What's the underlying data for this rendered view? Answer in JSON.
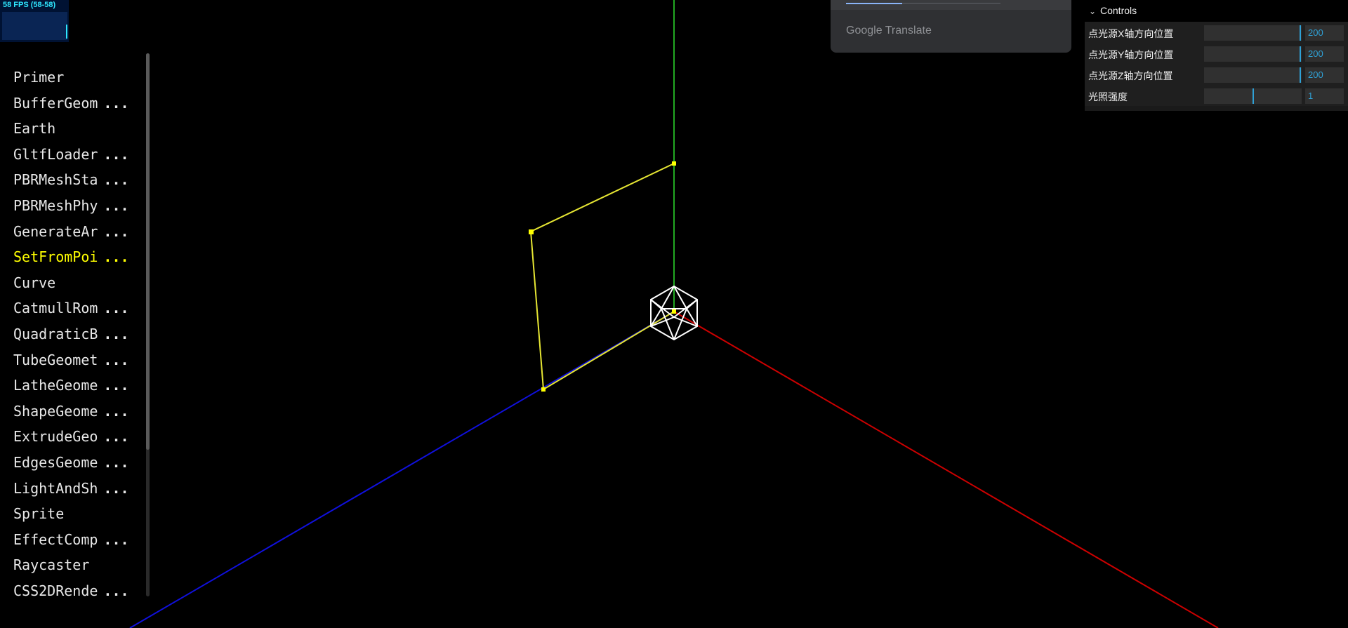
{
  "stats": {
    "fps_text": "58 FPS (58-58)"
  },
  "sidebar": {
    "items": [
      {
        "label": "Primer",
        "truncated": false,
        "active": false
      },
      {
        "label": "BufferGeom",
        "truncated": true,
        "active": false
      },
      {
        "label": "Earth",
        "truncated": false,
        "active": false
      },
      {
        "label": "GltfLoader",
        "truncated": true,
        "active": false
      },
      {
        "label": "PBRMeshSta",
        "truncated": true,
        "active": false
      },
      {
        "label": "PBRMeshPhy",
        "truncated": true,
        "active": false
      },
      {
        "label": "GenerateAr",
        "truncated": true,
        "active": false
      },
      {
        "label": "SetFromPoi",
        "truncated": true,
        "active": true
      },
      {
        "label": "Curve",
        "truncated": false,
        "active": false
      },
      {
        "label": "CatmullRom",
        "truncated": true,
        "active": false
      },
      {
        "label": "QuadraticB",
        "truncated": true,
        "active": false
      },
      {
        "label": "TubeGeomet",
        "truncated": true,
        "active": false
      },
      {
        "label": "LatheGeome",
        "truncated": true,
        "active": false
      },
      {
        "label": "ShapeGeome",
        "truncated": true,
        "active": false
      },
      {
        "label": "ExtrudeGeo",
        "truncated": true,
        "active": false
      },
      {
        "label": "EdgesGeome",
        "truncated": true,
        "active": false
      },
      {
        "label": "LightAndSh",
        "truncated": true,
        "active": false
      },
      {
        "label": "Sprite",
        "truncated": false,
        "active": false
      },
      {
        "label": "EffectComp",
        "truncated": true,
        "active": false
      },
      {
        "label": "Raycaster",
        "truncated": false,
        "active": false
      },
      {
        "label": "CSS2DRende",
        "truncated": true,
        "active": false
      }
    ],
    "ellipsis": "..."
  },
  "translate": {
    "brand": "Google Translate"
  },
  "controls": {
    "title": "Controls",
    "rows": [
      {
        "label": "点光源X轴方向位置",
        "value": "200",
        "level": 0.99
      },
      {
        "label": "点光源Y轴方向位置",
        "value": "200",
        "level": 0.99
      },
      {
        "label": "点光源Z轴方向位置",
        "value": "200",
        "level": 0.99
      },
      {
        "label": "光照强度",
        "value": "1",
        "level": 0.5
      }
    ]
  },
  "colors": {
    "x_axis": "#cc0000",
    "y_axis": "#22aa22",
    "z_axis": "#1010dd",
    "line": "#e6e633",
    "mesh": "#ffffff",
    "accent": "#2fa1d6",
    "active_item": "#ffff00"
  }
}
